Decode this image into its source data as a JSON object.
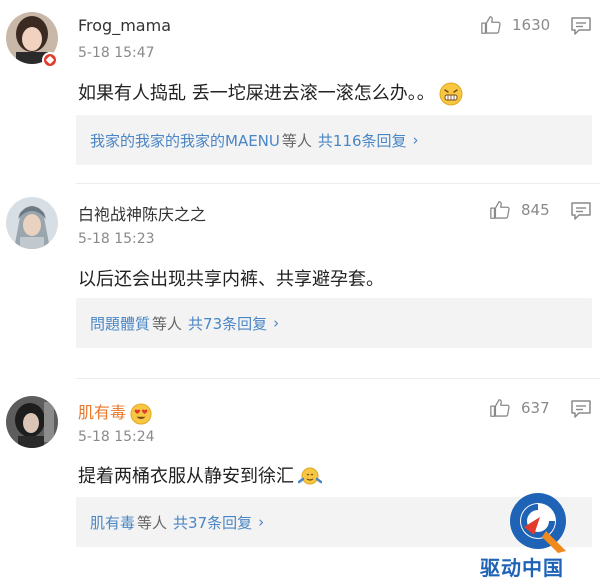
{
  "comments": [
    {
      "username": "Frog_mama",
      "time": "5-18 15:47",
      "text": "如果有人捣乱 丢一坨屎进去滚一滚怎么办。。",
      "likes": "1630",
      "reply_users": "我家的我家的我家的MAENU",
      "reply_mid": "等人",
      "reply_count": "共116条回复",
      "avatar_icon": "avatar-frog-mama",
      "emoji_icon": "grimace-emoji"
    },
    {
      "username": "白袍战神陈庆之之",
      "time": "5-18 15:23",
      "text": "以后还会出现共享内裤、共享避孕套。",
      "likes": "845",
      "reply_users": "問題體質",
      "reply_mid": "等人",
      "reply_count": "共73条回复",
      "avatar_icon": "avatar-warrior"
    },
    {
      "username": "肌有毒",
      "time": "5-18 15:24",
      "text": "提着两桶衣服从静安到徐汇",
      "likes": "637",
      "reply_users": "肌有毒",
      "reply_mid": "等人",
      "reply_count": "共37条回复",
      "avatar_icon": "avatar-girl",
      "username_color": "#e8792c",
      "emoji_icon": "shrug-emoji"
    }
  ],
  "chevron": "›",
  "watermark": {
    "text": "驱动中国",
    "brand_color": "#1e63b5",
    "accent_color": "#f08a1c"
  }
}
